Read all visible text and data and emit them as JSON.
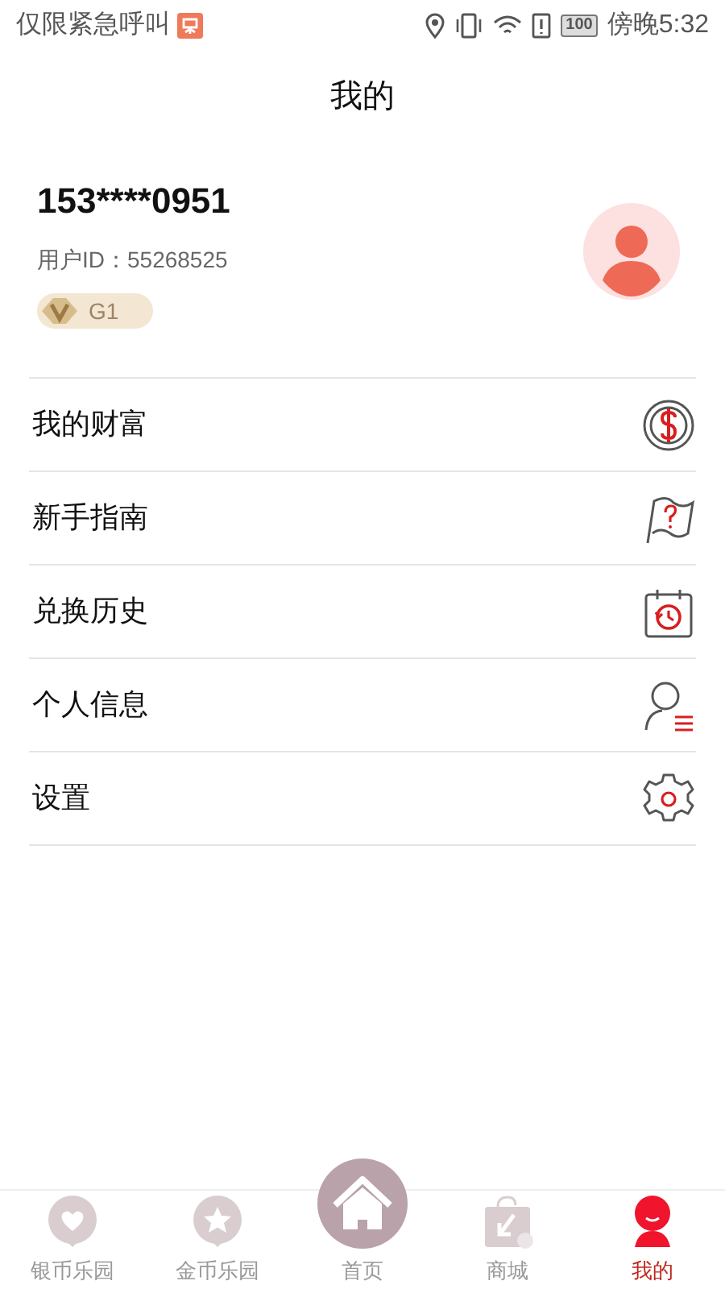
{
  "status_bar": {
    "carrier": "仅限紧急呼叫",
    "battery": "100",
    "time": "傍晚5:32"
  },
  "title": "我的",
  "profile": {
    "phone": "153****0951",
    "user_id_label": "用户ID：",
    "user_id": "55268525",
    "level": "G1"
  },
  "menu": [
    {
      "kind": "wealth",
      "label": "我的财富"
    },
    {
      "kind": "guide",
      "label": "新手指南"
    },
    {
      "kind": "history",
      "label": "兑换历史"
    },
    {
      "kind": "info",
      "label": "个人信息"
    },
    {
      "kind": "settings",
      "label": "设置"
    }
  ],
  "tabs": [
    {
      "kind": "heart",
      "label": "银币乐园",
      "selected": false
    },
    {
      "kind": "star",
      "label": "金币乐园",
      "selected": false
    },
    {
      "kind": "home",
      "label": "首页",
      "selected": false
    },
    {
      "kind": "shop",
      "label": "商城",
      "selected": false
    },
    {
      "kind": "me",
      "label": "我的",
      "selected": true
    }
  ]
}
